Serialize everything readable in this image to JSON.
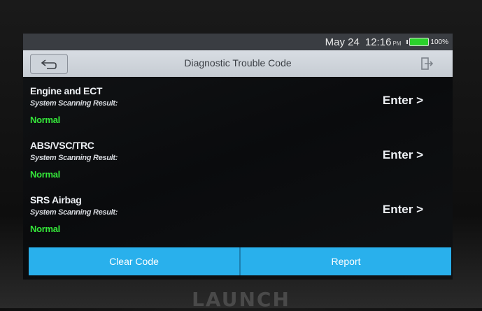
{
  "status": {
    "date": "May 24",
    "time": "12:16",
    "ampm": "PM",
    "battery": "100%",
    "battery_color": "#2bd12b"
  },
  "header": {
    "title": "Diagnostic Trouble Code",
    "back_icon": "back-arrow-icon",
    "exit_icon": "exit-icon"
  },
  "systems": [
    {
      "name": "Engine and ECT",
      "result_label": "System Scanning Result:",
      "status": "Normal",
      "action": "Enter >"
    },
    {
      "name": "ABS/VSC/TRC",
      "result_label": "System Scanning Result:",
      "status": "Normal",
      "action": "Enter >"
    },
    {
      "name": "SRS Airbag",
      "result_label": "System Scanning Result:",
      "status": "Normal",
      "action": "Enter >"
    }
  ],
  "footer": {
    "clear_label": "Clear Code",
    "report_label": "Report",
    "accent": "#29b0ec"
  },
  "device": {
    "brand": "LAUNCH"
  }
}
